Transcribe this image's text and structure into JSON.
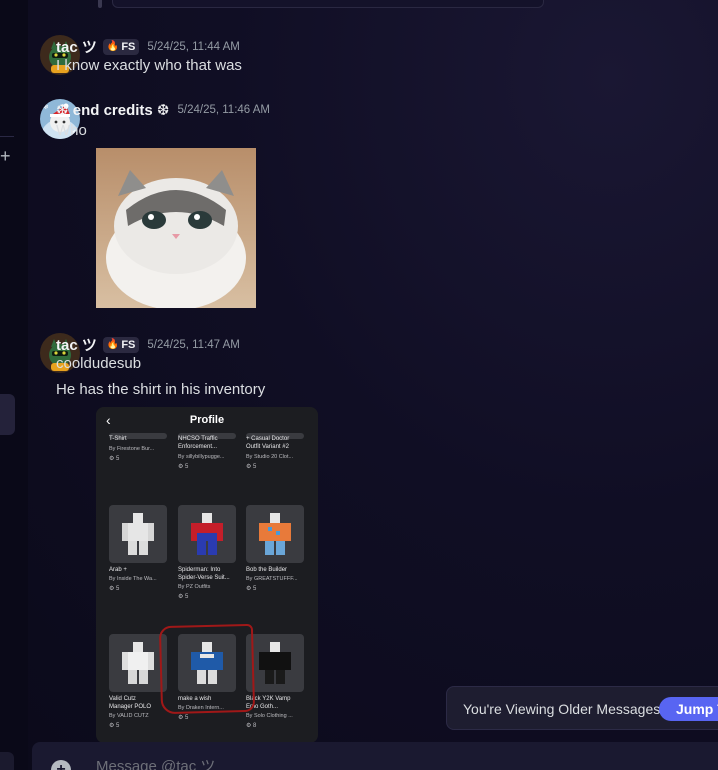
{
  "messages": [
    {
      "username": "tac ツ",
      "tag": "FS",
      "time": "5/24/25, 11:44 AM",
      "text": "I know exactly who that was"
    },
    {
      "username": "❆ end credits ❆",
      "time": "5/24/25, 11:46 AM",
      "text": "Who"
    },
    {
      "username": "tac ツ",
      "tag": "FS",
      "time": "5/24/25, 11:47 AM",
      "text1": "cooldudesub",
      "text2": "He has the shirt in his inventory"
    }
  ],
  "profile": {
    "title": "Profile",
    "top_row": [
      {
        "name": "T-Shirt",
        "by": "By Firestone Bur...",
        "count": "5"
      },
      {
        "name": "NHCSO Traffic\nEnforcement...",
        "by": "By sillybillypugge...",
        "count": "5"
      },
      {
        "name": "+ Casual Doctor\nOutfit Variant #2",
        "by": "By Studio 20 Clot...",
        "count": "5"
      }
    ],
    "mid_row": [
      {
        "name": "Arab +",
        "by": "By Inside The Wa...",
        "count": "5",
        "color": "#e6e6e6"
      },
      {
        "name": "Spiderman: Into\nSpider-Verse Suit...",
        "by": "By PZ Outfits",
        "count": "5",
        "color": "#c41e2a"
      },
      {
        "name": "Bob the Builder",
        "by": "By GREATSTUFFF...",
        "count": "5",
        "color": "#e87a3a"
      }
    ],
    "bottom_row": [
      {
        "name": "Valid Cutz\nManager POLO",
        "by": "By VALID CUTZ",
        "count": "5",
        "color": "#e6e6e6"
      },
      {
        "name": "make a wish",
        "by": "By Draken Intern...",
        "count": "5",
        "color": "#1f5aa8"
      },
      {
        "name": "Black Y2K Vamp\nEmo Goth...",
        "by": "By Solo Clothing ...",
        "count": "8",
        "color": "#111111"
      }
    ]
  },
  "banner": {
    "label": "You're Viewing Older Messages",
    "jump": "Jump To Present"
  },
  "composer": {
    "placeholder": "Message @tac ツ"
  }
}
